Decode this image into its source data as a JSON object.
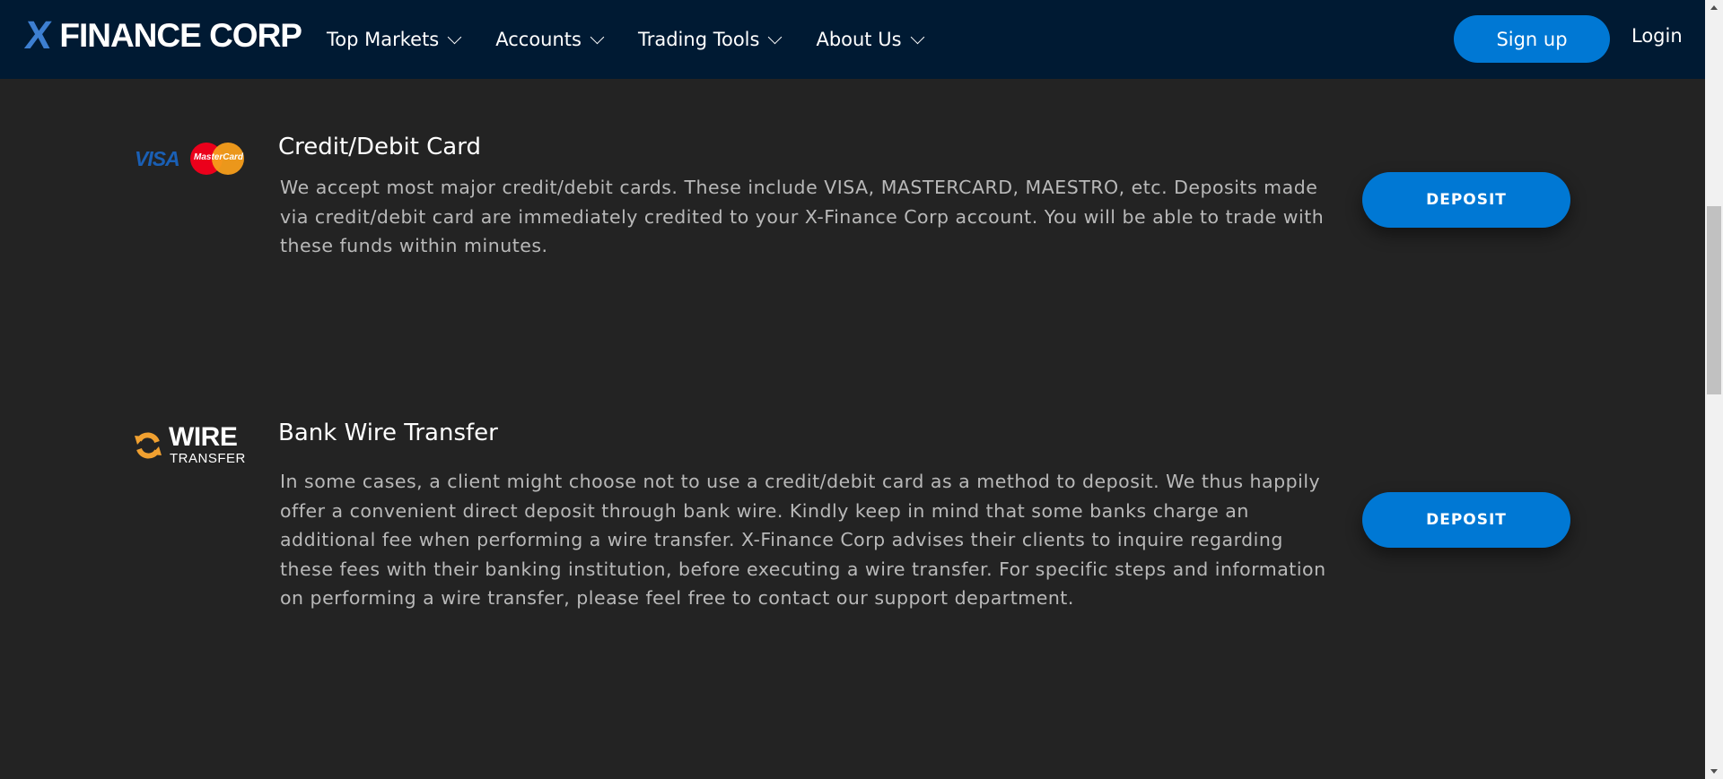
{
  "brand": {
    "logo_x": "X",
    "logo_text": "FINANCE CORP"
  },
  "nav": {
    "items": [
      {
        "label": "Top Markets"
      },
      {
        "label": "Accounts"
      },
      {
        "label": "Trading Tools"
      },
      {
        "label": "About Us"
      }
    ],
    "signup_label": "Sign up",
    "login_label": "Login"
  },
  "methods": [
    {
      "title": "Credit/Debit Card",
      "description": "We accept most major credit/debit cards. These include VISA, MASTERCARD, MAESTRO, etc. Deposits made via credit/debit card are immediately credited to your X-Finance Corp account. You will be able to trade with these funds within minutes.",
      "button_label": "DEPOSIT",
      "logo": {
        "visa_text": "VISA",
        "mastercard_text": "MasterCard"
      }
    },
    {
      "title": "Bank Wire Transfer",
      "description": "In some cases, a client might choose not to use a credit/debit card as a method to deposit. We thus happily offer a convenient direct deposit through bank wire. Kindly keep in mind that some banks charge an additional fee when performing a wire transfer. X-Finance Corp advises their clients to inquire regarding these fees with their banking institution, before executing a wire transfer. For specific steps and information on performing a wire transfer, please feel free to contact our support department.",
      "button_label": "DEPOSIT",
      "logo": {
        "big_text": "WIRE",
        "small_text": "TRANSFER"
      }
    }
  ],
  "colors": {
    "header_bg": "#001a33",
    "page_bg": "#232323",
    "accent": "#0078d4",
    "logo_x": "#3d7fd1"
  }
}
